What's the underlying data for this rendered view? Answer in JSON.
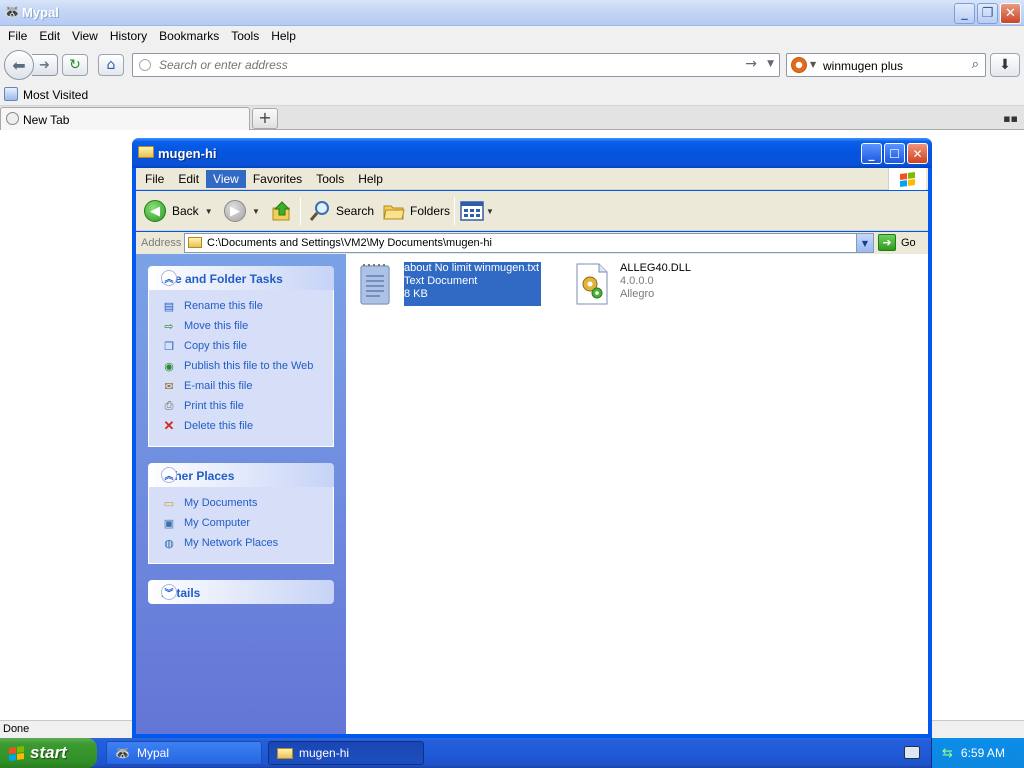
{
  "browser": {
    "title": "Mypal",
    "menu": [
      "File",
      "Edit",
      "View",
      "History",
      "Bookmarks",
      "Tools",
      "Help"
    ],
    "url_placeholder": "Search or enter address",
    "search_value": "winmugen plus",
    "bookmark_label": "Most Visited",
    "tab_label": "New Tab",
    "status": "Done"
  },
  "explorer": {
    "title": "mugen-hi",
    "menu": [
      "File",
      "Edit",
      "View",
      "Favorites",
      "Tools",
      "Help"
    ],
    "active_menu_index": 2,
    "toolbar": {
      "back": "Back",
      "search": "Search",
      "folders": "Folders"
    },
    "address_label": "Address",
    "address_path": "C:\\Documents and Settings\\VM2\\My Documents\\mugen-hi",
    "go_label": "Go",
    "file_tasks": {
      "title": "File and Folder Tasks",
      "items": [
        "Rename this file",
        "Move this file",
        "Copy this file",
        "Publish this file to the Web",
        "E-mail this file",
        "Print this file",
        "Delete this file"
      ]
    },
    "other_places": {
      "title": "Other Places",
      "items": [
        "My Documents",
        "My Computer",
        "My Network Places"
      ]
    },
    "details_title": "Details",
    "files": [
      {
        "name": "about No limit winmugen.txt",
        "type": "Text Document",
        "size": "8 KB",
        "selected": true
      },
      {
        "name": "ALLEG40.DLL",
        "type": "4.0.0.0",
        "size": "Allegro",
        "selected": false
      }
    ]
  },
  "taskbar": {
    "start_label": "start",
    "tasks": [
      "Mypal",
      "mugen-hi"
    ],
    "clock": "6:59 AM"
  },
  "colors": {
    "xp_blue": "#0058ee",
    "selection": "#316ac5",
    "link_blue": "#215dc6",
    "start_green": "#3c9b30"
  }
}
